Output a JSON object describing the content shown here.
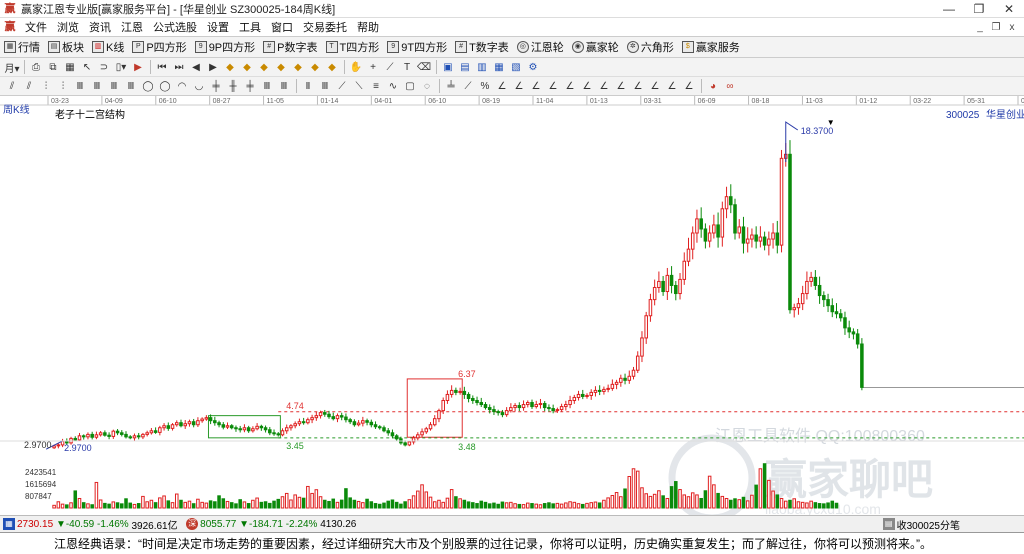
{
  "window": {
    "title": "赢家江恩专业版[赢家服务平台] - [华星创业  SZ300025-184周K线]",
    "minimize": "—",
    "restore": "❐",
    "close": "✕"
  },
  "menu": {
    "items": [
      "文件",
      "浏览",
      "资讯",
      "江恩",
      "公式选股",
      "设置",
      "工具",
      "窗口",
      "交易委托",
      "帮助"
    ],
    "mdi_minimize": "_",
    "mdi_restore": "❐",
    "mdi_close": "x"
  },
  "toolbar": {
    "items": [
      {
        "label": "行情",
        "icon": "grid-icon"
      },
      {
        "label": "板块",
        "icon": "blocks-icon"
      },
      {
        "label": "K线",
        "icon": "kline-icon"
      },
      {
        "label": "P四方形",
        "icon": "p-square-icon"
      },
      {
        "label": "9P四方形",
        "icon": "9p-square-icon"
      },
      {
        "label": "P数字表",
        "icon": "p-number-table-icon"
      },
      {
        "label": "T四方形",
        "icon": "t-square-icon"
      },
      {
        "label": "9T四方形",
        "icon": "9t-square-icon"
      },
      {
        "label": "T数字表",
        "icon": "t-number-table-icon"
      },
      {
        "label": "江恩轮",
        "icon": "gann-wheel-icon"
      },
      {
        "label": "赢家轮",
        "icon": "winner-wheel-icon"
      },
      {
        "label": "六角形",
        "icon": "hexagon-icon"
      },
      {
        "label": "赢家服务",
        "icon": "service-icon"
      }
    ]
  },
  "chart_data": {
    "type": "candlestick",
    "period_label": "周K线",
    "title": "老子十二宫结构",
    "symbol": "300025",
    "name": "华星创业",
    "time_ticks": [
      "03-23",
      "04-09",
      "06-10",
      "08-27",
      "11-05",
      "01-14",
      "04-01",
      "06-10",
      "08-19",
      "11-04",
      "01-13",
      "03-31",
      "06-09",
      "08-18",
      "11-03",
      "01-12",
      "03-22",
      "05-31",
      "08-08"
    ],
    "price_ylim": [
      2.55,
      19.2
    ],
    "high_label": "18.3700",
    "low_label": "2.9700",
    "low_left_label": "2.9700",
    "annotations": [
      {
        "text": "4.74",
        "value": 4.74,
        "color": "#e03030",
        "line": "dashed"
      },
      {
        "text": "3.45",
        "value": 3.45,
        "color": "#2a9a2a",
        "line": "dashed"
      },
      {
        "text": "6.37",
        "value": 6.37,
        "color": "#e03030"
      },
      {
        "text": "3.48",
        "value": 3.48,
        "color": "#2a9a2a"
      }
    ],
    "boxes": [
      {
        "from_bar": 37,
        "to_bar": 53,
        "top": 4.55,
        "bottom": 3.45,
        "color": "#2a9a2a"
      },
      {
        "from_bar": 84,
        "to_bar": 96,
        "top": 6.37,
        "bottom": 3.48,
        "color": "#e03030"
      }
    ],
    "last_close": 5.95,
    "closes": [
      3.05,
      3.1,
      3.28,
      3.2,
      3.42,
      3.35,
      3.55,
      3.5,
      3.62,
      3.48,
      3.6,
      3.7,
      3.58,
      3.52,
      3.78,
      3.7,
      3.62,
      3.5,
      3.45,
      3.55,
      3.5,
      3.62,
      3.7,
      3.8,
      3.72,
      3.95,
      4.05,
      3.92,
      4.1,
      4.2,
      4.05,
      4.15,
      4.25,
      4.1,
      4.3,
      4.38,
      4.45,
      4.3,
      4.2,
      4.1,
      3.98,
      4.05,
      3.95,
      3.9,
      3.85,
      3.95,
      3.8,
      3.9,
      4.02,
      3.95,
      3.85,
      3.7,
      3.65,
      3.6,
      3.8,
      3.95,
      4.05,
      4.15,
      4.25,
      4.2,
      4.35,
      4.45,
      4.55,
      4.7,
      4.62,
      4.5,
      4.4,
      4.55,
      4.48,
      4.35,
      4.25,
      4.1,
      4.18,
      4.3,
      4.22,
      4.1,
      4.0,
      3.95,
      3.8,
      3.7,
      3.55,
      3.4,
      3.2,
      3.1,
      3.25,
      3.45,
      3.6,
      3.75,
      3.9,
      4.1,
      4.4,
      4.8,
      5.3,
      5.6,
      5.8,
      5.7,
      5.75,
      5.6,
      5.4,
      5.3,
      5.2,
      5.1,
      4.95,
      4.85,
      4.75,
      4.7,
      4.6,
      4.8,
      4.95,
      5.05,
      4.95,
      5.1,
      5.2,
      5.0,
      5.1,
      5.15,
      4.95,
      4.9,
      4.8,
      4.85,
      5.0,
      5.1,
      5.3,
      5.45,
      5.6,
      5.5,
      5.55,
      5.7,
      5.8,
      5.75,
      5.85,
      5.9,
      6.1,
      6.2,
      6.4,
      6.3,
      6.5,
      6.8,
      7.5,
      8.4,
      9.5,
      10.3,
      10.9,
      11.2,
      10.7,
      11.5,
      11.0,
      10.6,
      11.3,
      12.2,
      12.8,
      13.6,
      14.3,
      13.8,
      13.2,
      13.6,
      14.0,
      13.4,
      14.8,
      15.4,
      15.0,
      13.6,
      13.9,
      13.1,
      13.3,
      13.5,
      13.2,
      13.4,
      13.0,
      13.3,
      13.6,
      13.0,
      17.3,
      17.5,
      9.8,
      9.9,
      10.1,
      10.6,
      11.2,
      11.4,
      11.0,
      10.5,
      10.3,
      10.0,
      9.7,
      9.6,
      9.4,
      8.9,
      8.7,
      8.6,
      8.1,
      5.95
    ],
    "volume_ticks": [
      "2423541",
      "1615694",
      "807847"
    ],
    "volume_ylim": [
      0,
      3230000
    ],
    "volumes": [
      180000,
      420000,
      260000,
      210000,
      350000,
      1150000,
      640000,
      360000,
      280000,
      220000,
      1720000,
      540000,
      310000,
      260000,
      410000,
      350000,
      280000,
      620000,
      330000,
      240000,
      300000,
      780000,
      420000,
      520000,
      360000,
      680000,
      810000,
      480000,
      360000,
      940000,
      520000,
      380000,
      460000,
      290000,
      590000,
      380000,
      330000,
      480000,
      420000,
      820000,
      620000,
      440000,
      360000,
      280000,
      560000,
      410000,
      300000,
      520000,
      670000,
      380000,
      420000,
      310000,
      460000,
      580000,
      760000,
      980000,
      540000,
      880000,
      720000,
      660000,
      1450000,
      980000,
      1230000,
      760000,
      520000,
      440000,
      600000,
      380000,
      530000,
      1300000,
      680000,
      520000,
      440000,
      360000,
      590000,
      420000,
      300000,
      250000,
      330000,
      460000,
      540000,
      380000,
      260000,
      420000,
      560000,
      820000,
      1140000,
      1560000,
      1080000,
      730000,
      420000,
      520000,
      380000,
      660000,
      1240000,
      760000,
      620000,
      520000,
      410000,
      360000,
      300000,
      460000,
      380000,
      280000,
      330000,
      250000,
      400000,
      350000,
      380000,
      290000,
      240000,
      230000,
      330000,
      300000,
      260000,
      220000,
      300000,
      350000,
      280000,
      310000,
      260000,
      340000,
      420000,
      380000,
      290000,
      240000,
      310000,
      360000,
      400000,
      340000,
      520000,
      680000,
      840000,
      1040000,
      760000,
      1280000,
      2120000,
      2640000,
      2480000,
      1360000,
      960000,
      780000,
      920000,
      1160000,
      820000,
      640000,
      1440000,
      1780000,
      1240000,
      880000,
      760000,
      1020000,
      880000,
      640000,
      1160000,
      2140000,
      1560000,
      980000,
      780000,
      640000,
      520000,
      620000,
      560000,
      720000,
      480000,
      860000,
      1540000,
      2640000,
      2980000,
      1860000,
      1140000,
      880000,
      640000,
      460000,
      520000,
      620000,
      420000,
      380000,
      340000,
      460000,
      360000,
      300000,
      280000,
      340000,
      460000,
      320000
    ]
  },
  "watermark": {
    "line1": "江恩工具软件  QQ:100800360",
    "line2": "赢家聊吧",
    "line3": "liaoba.ycxd10.com"
  },
  "status": {
    "index1_value": "2730.15",
    "index1_change": "▼-40.59",
    "index1_pct": "-1.46%",
    "index1_amount": "3926.61亿",
    "index2_value": "8055.77",
    "index2_change": "▼-184.71",
    "index2_pct": "-2.24%",
    "index2_amount": "4130.26",
    "right_label": "收300025分笔"
  },
  "footer": {
    "quote": "江恩经典语录：“时间是决定市场走势的重要因素，经过详细研究大市及个别股票的过往记录，你将可以证明，历史确实重复发生；而了解过往，你将可以预测将来。”。"
  }
}
